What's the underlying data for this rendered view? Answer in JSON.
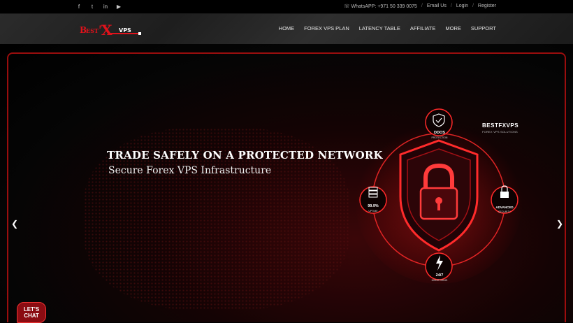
{
  "social": [
    {
      "icon": "facebook-icon",
      "glyph": "f"
    },
    {
      "icon": "twitter-icon",
      "glyph": "t"
    },
    {
      "icon": "linkedin-icon",
      "glyph": "in"
    },
    {
      "icon": "youtube-icon",
      "glyph": "▶"
    }
  ],
  "topbar": {
    "whatsapp": "WhatsAPP: +971 50 339 0075",
    "email": "Email Us",
    "login": "Login",
    "register": "Register"
  },
  "logo": {
    "text_left": "BEST",
    "text_mid": "FX",
    "text_right": "VPS"
  },
  "nav": [
    "HOME",
    "FOREX VPS PLAN",
    "LATENCY TABLE",
    "AFFILIATE",
    "MORE",
    "SUPPORT"
  ],
  "hero": {
    "headline": "TRADE SAFELY ON A PROTECTED NETWORK",
    "subline": "Secure Forex VPS Infrastructure",
    "brand": "BESTFXVPS",
    "brand_tag": "FOREX VPS SOLUTIONS",
    "badges": {
      "ddos_title": "DDOS",
      "ddos_sub": "PROTECTION",
      "uptime_title": "99.9%",
      "uptime_sub": "UPTIME",
      "security_title": "ADVANCED",
      "security_sub": "SECURITY",
      "monitor_title": "24/7",
      "monitor_sub": "MONITORING"
    }
  },
  "chat": {
    "line1": "LET'S",
    "line2": "CHAT"
  },
  "colors": {
    "accent": "#e0121b",
    "frame": "#cc1111",
    "header_bg": "#262626"
  }
}
